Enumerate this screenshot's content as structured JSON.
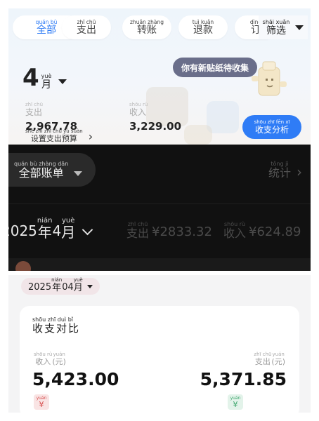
{
  "top": {
    "tabs": [
      {
        "pinyin": "quán bù",
        "label": "全部"
      },
      {
        "pinyin": "zhī chū",
        "label": "支出"
      },
      {
        "pinyin": "zhuǎn zhàng",
        "label": "转账"
      },
      {
        "pinyin": "tuì kuǎn",
        "label": "退款"
      },
      {
        "pinyin": "dìng",
        "label": "订"
      }
    ],
    "filter": {
      "pinyin": "shāi xuǎn",
      "label": "筛选"
    },
    "month": {
      "number": "4",
      "unit_pinyin": "yuè",
      "unit": "月"
    },
    "sticker_banner": "你有新贴纸待收集",
    "expense": {
      "pinyin": "zhī chū",
      "label": "支出",
      "value": "2,967.78"
    },
    "income": {
      "pinyin": "shōu rù",
      "label": "收入",
      "value": "3,229.00"
    },
    "budget": {
      "pinyin": "shè zhì zhī chū yù suàn",
      "label": "设置支出预算"
    },
    "analysis_button": {
      "pinyin": "shōu zhī fēn xī",
      "label": "收支分析"
    },
    "colors": {
      "accent": "#2f7cf6"
    }
  },
  "dark": {
    "all_bills": {
      "pinyin": "quán bù zhàng dān",
      "label": "全部账单"
    },
    "stats": {
      "pinyin": "tǒng jì",
      "label": "统计"
    },
    "date": {
      "year": "2025",
      "year_pinyin": "nián",
      "year_char": "年",
      "month": "4",
      "month_pinyin": "yuè",
      "month_char": "月"
    },
    "expense": {
      "pinyin": "zhī chū",
      "label": "支出",
      "value": "¥2833.32"
    },
    "income": {
      "pinyin": "shōu rù",
      "label": "收入",
      "value": "¥624.89"
    }
  },
  "bottom": {
    "date": {
      "year": "2025",
      "year_pinyin": "nián",
      "year_char": "年",
      "month": "04",
      "month_pinyin": "yuè",
      "month_char": "月"
    },
    "card_title": {
      "pinyin": "shōu zhī duì bǐ",
      "label": "收支对比"
    },
    "income": {
      "pinyin": "shōu rù",
      "label": "收入",
      "unit_pinyin": "yuán",
      "unit": "(元)",
      "value": "5,423.00"
    },
    "expense": {
      "pinyin": "zhī chū",
      "label": "支出",
      "unit_pinyin": "yuán",
      "unit": "(元)",
      "value": "5,371.85"
    },
    "yen_icon": {
      "pinyin": "yuán",
      "char": "¥"
    },
    "colors": {
      "income": "#c7433f",
      "expense": "#2f9a66"
    }
  }
}
